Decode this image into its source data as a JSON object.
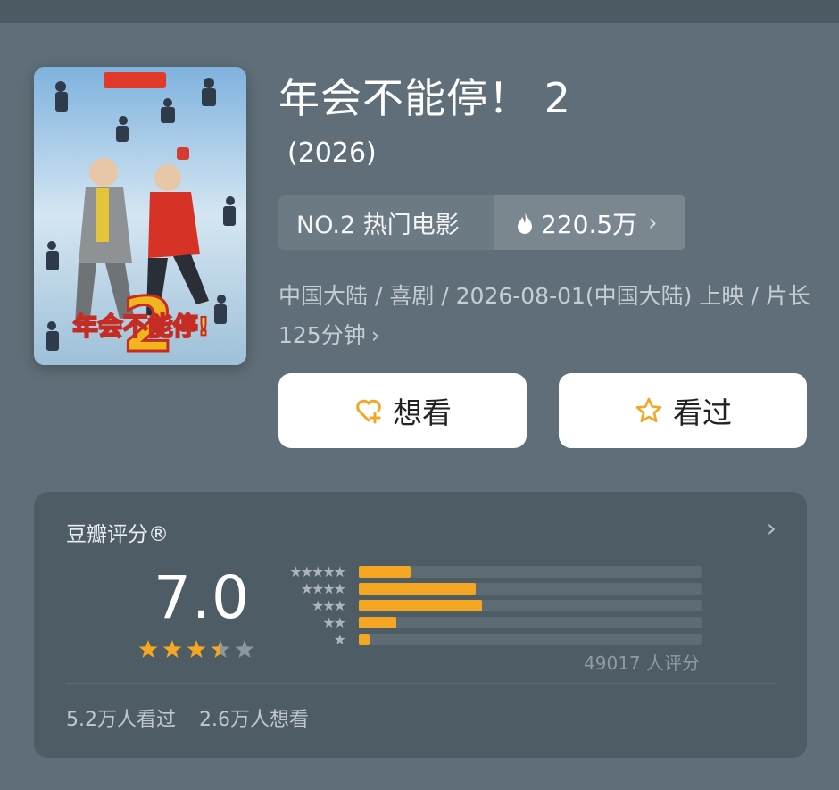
{
  "movie": {
    "title": "年会不能停！ 2",
    "year": "(2026)",
    "rank_label": "NO.2 热门电影",
    "heat": "220.5万",
    "meta": "中国大陆 / 喜剧 / 2026-08-01(中国大陆) 上映 / 片长125分钟",
    "poster_title": "年会不能停!",
    "poster_number": "2"
  },
  "actions": {
    "want_label": "想看",
    "seen_label": "看过"
  },
  "rating": {
    "title": "豆瓣评分®",
    "score": "7.0",
    "stars_value": 3.5,
    "distribution": [
      {
        "stars": 5,
        "fraction": 0.15
      },
      {
        "stars": 4,
        "fraction": 0.34
      },
      {
        "stars": 3,
        "fraction": 0.36
      },
      {
        "stars": 2,
        "fraction": 0.11
      },
      {
        "stars": 1,
        "fraction": 0.03
      }
    ],
    "count": "49017 人评分",
    "seen_count": "5.2万人看过",
    "want_count": "2.6万人想看"
  },
  "colors": {
    "background": "#5f6e78",
    "card": "#4e5c66",
    "accent": "#f5a623",
    "star_empty": "#8c979d"
  },
  "icons": [
    "flame-icon",
    "chevron-right-icon",
    "heart-plus-icon",
    "star-outline-icon",
    "star-icon"
  ]
}
